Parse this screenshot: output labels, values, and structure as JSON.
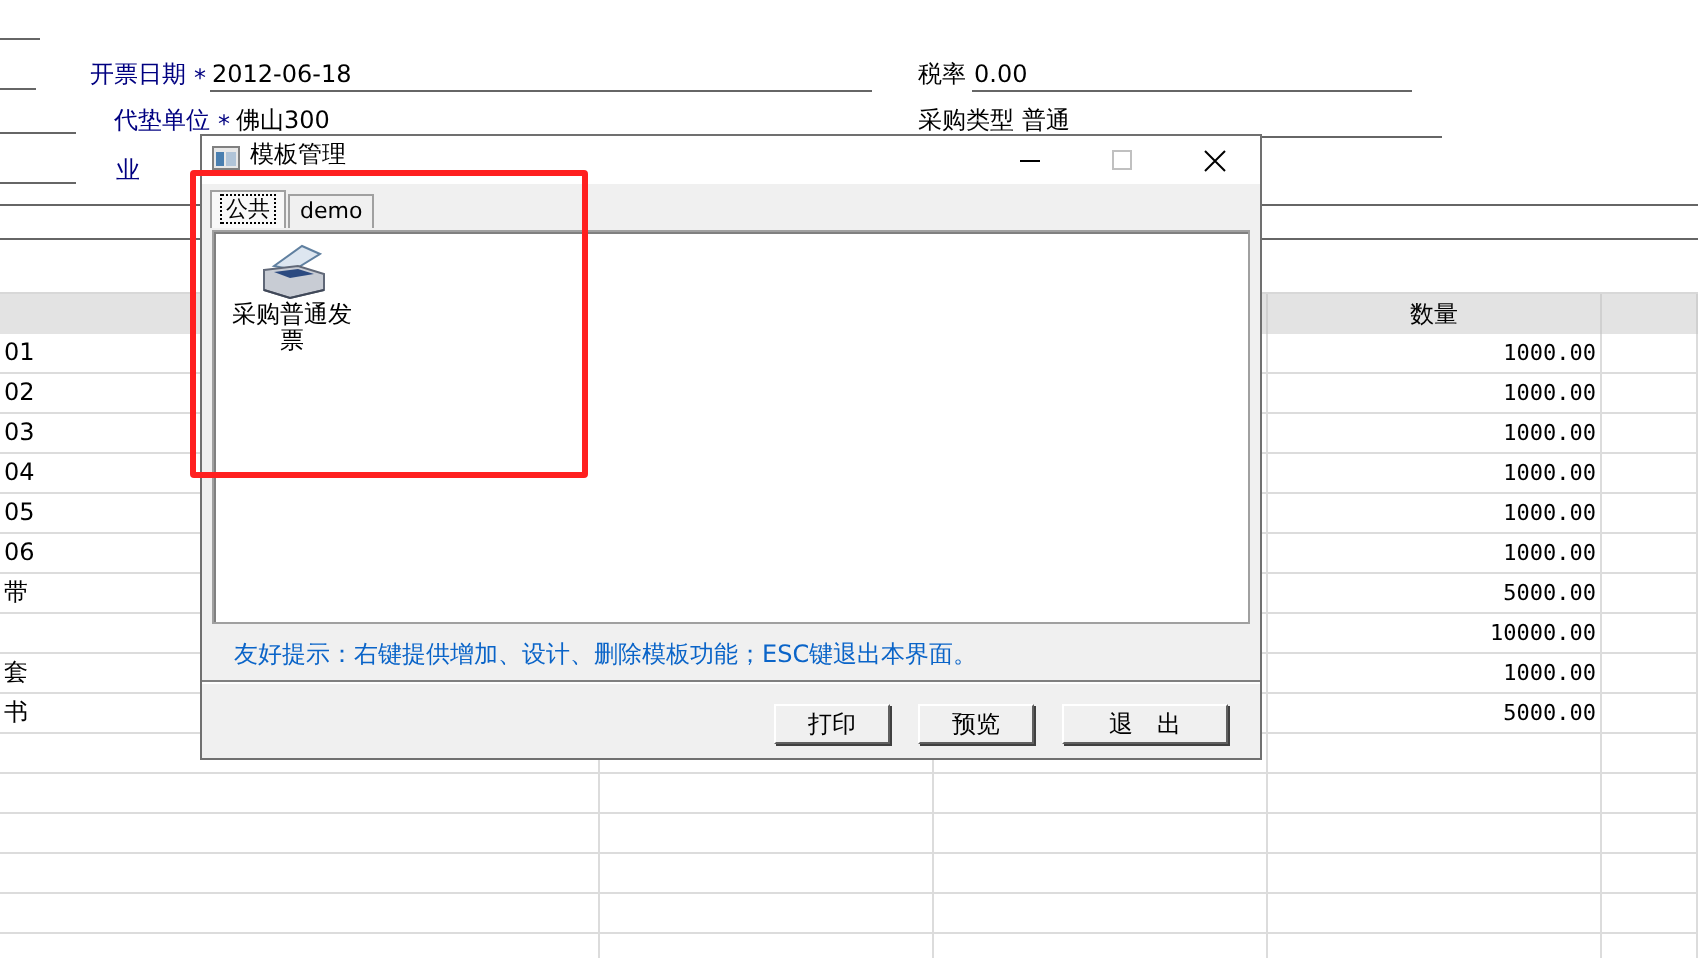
{
  "form": {
    "rows": [
      [
        {
          "label": "开票日期",
          "mark": "*",
          "value": "2012-06-18"
        },
        {
          "label": "税率",
          "value": "0.00"
        }
      ],
      [
        {
          "label": "代垫单位",
          "mark": "*",
          "value": "佛山300"
        },
        {
          "label": "采购类型",
          "value": "普通"
        }
      ],
      [
        {
          "label": "业"
        }
      ]
    ]
  },
  "table": {
    "quantity_heading": "数量",
    "rows": [
      {
        "column_1": "01",
        "quantity": "1000.00"
      },
      {
        "column_1": "02",
        "quantity": "1000.00"
      },
      {
        "column_1": "03",
        "quantity": "1000.00"
      },
      {
        "column_1": "04",
        "quantity": "1000.00"
      },
      {
        "column_1": "05",
        "quantity": "1000.00"
      },
      {
        "column_1": "06",
        "quantity": "1000.00"
      },
      {
        "column_1": "带",
        "quantity": "5000.00"
      },
      {
        "quantity": "10000.00"
      },
      {
        "column_1": "套",
        "quantity": "1000.00"
      },
      {
        "column_1": "书",
        "quantity": "5000.00"
      }
    ]
  },
  "dialog": {
    "title": "模板管理",
    "tabs": [
      {
        "label": "公共",
        "selected": true
      },
      {
        "label": "demo",
        "selected": false
      }
    ],
    "templates": [
      {
        "label": "采购普通发票"
      }
    ],
    "hint": "友好提示：右键提供增加、设计、删除模板功能；ESC键退出本界面。",
    "buttons": [
      "打印",
      "预览",
      "退　出"
    ]
  }
}
